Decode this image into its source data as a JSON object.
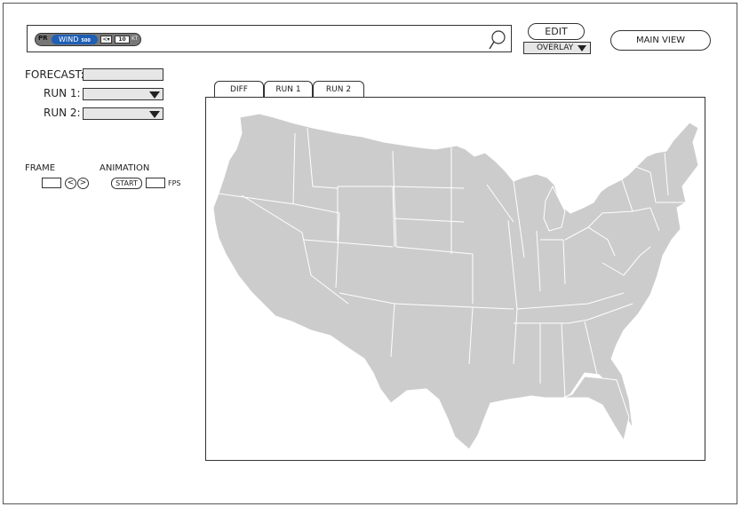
{
  "search_bar": {
    "layer_chip": {
      "prefix": "PR",
      "variable": "WIND",
      "level": "500",
      "operator": "<",
      "value": "10",
      "unit": "KT"
    }
  },
  "toolbar": {
    "edit_label": "EDIT",
    "overlay_label": "OVERLAY",
    "main_view_label": "MAIN VIEW"
  },
  "controls": {
    "forecast_label": "FORECAST:",
    "forecast_value": "",
    "run1_label": "RUN 1:",
    "run1_value": "",
    "run2_label": "RUN 2:",
    "run2_value": "",
    "frame_label": "FRAME",
    "frame_value": "",
    "prev_glyph": "<",
    "next_glyph": ">",
    "animation_label": "ANIMATION",
    "start_label": "START",
    "fps_value": "",
    "fps_label": "FPS"
  },
  "tabs": [
    {
      "label": "DIFF",
      "active": true
    },
    {
      "label": "RUN 1",
      "active": false
    },
    {
      "label": "RUN 2",
      "active": false
    }
  ],
  "map": {
    "region": "contiguous United States",
    "fill_color": "#cccccc",
    "border_color": "#ffffff"
  }
}
